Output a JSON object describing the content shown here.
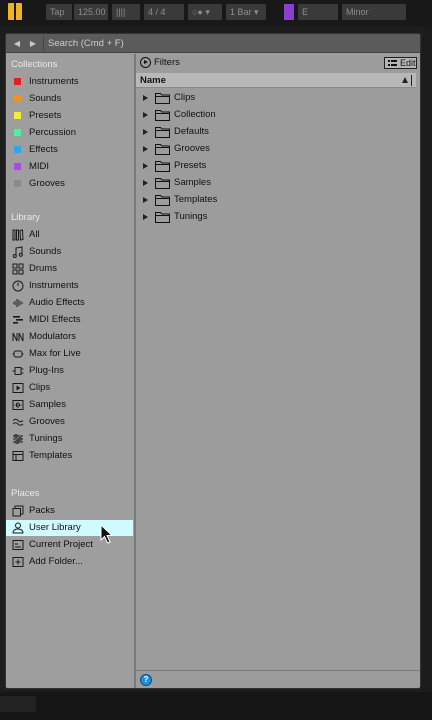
{
  "topbar": {
    "tap_label": "Tap",
    "tempo": "125.00",
    "meter_marks": "||||",
    "signature": "4 / 4",
    "rec_controls": "○● ▾",
    "quantize": "1 Bar ▾",
    "key": "E",
    "scale": "Minor"
  },
  "search": {
    "placeholder": "Search (Cmd + F)",
    "value": ""
  },
  "collections": {
    "title": "Collections",
    "items": [
      {
        "label": "Instruments",
        "color": "#e0221e"
      },
      {
        "label": "Sounds",
        "color": "#f0941e"
      },
      {
        "label": "Presets",
        "color": "#f3ef39"
      },
      {
        "label": "Percussion",
        "color": "#4ef09a"
      },
      {
        "label": "Effects",
        "color": "#2fa6f0"
      },
      {
        "label": "MIDI",
        "color": "#a54de9"
      },
      {
        "label": "Grooves",
        "color": "#8b8b8b"
      }
    ]
  },
  "library": {
    "title": "Library",
    "items": [
      {
        "label": "All",
        "icon": "all-icon"
      },
      {
        "label": "Sounds",
        "icon": "note-icon"
      },
      {
        "label": "Drums",
        "icon": "drum-grid-icon"
      },
      {
        "label": "Instruments",
        "icon": "clock-knob-icon"
      },
      {
        "label": "Audio Effects",
        "icon": "waveform-icon"
      },
      {
        "label": "MIDI Effects",
        "icon": "midi-bars-icon"
      },
      {
        "label": "Modulators",
        "icon": "modulator-icon"
      },
      {
        "label": "Max for Live",
        "icon": "max-icon"
      },
      {
        "label": "Plug-Ins",
        "icon": "plug-icon"
      },
      {
        "label": "Clips",
        "icon": "clip-play-icon"
      },
      {
        "label": "Samples",
        "icon": "sample-wave-icon"
      },
      {
        "label": "Grooves",
        "icon": "groove-icon"
      },
      {
        "label": "Tunings",
        "icon": "tuning-icon"
      },
      {
        "label": "Templates",
        "icon": "template-icon"
      }
    ]
  },
  "places": {
    "title": "Places",
    "items": [
      {
        "label": "Packs",
        "icon": "packs-icon"
      },
      {
        "label": "User Library",
        "icon": "user-icon",
        "selected": true
      },
      {
        "label": "Current Project",
        "icon": "project-icon"
      },
      {
        "label": "Add Folder...",
        "icon": "add-folder-icon"
      }
    ]
  },
  "main": {
    "filters_label": "Filters",
    "edit_label": "Edit",
    "column_name": "Name",
    "folders": [
      "Clips",
      "Collection",
      "Defaults",
      "Grooves",
      "Presets",
      "Samples",
      "Templates",
      "Tunings"
    ]
  }
}
